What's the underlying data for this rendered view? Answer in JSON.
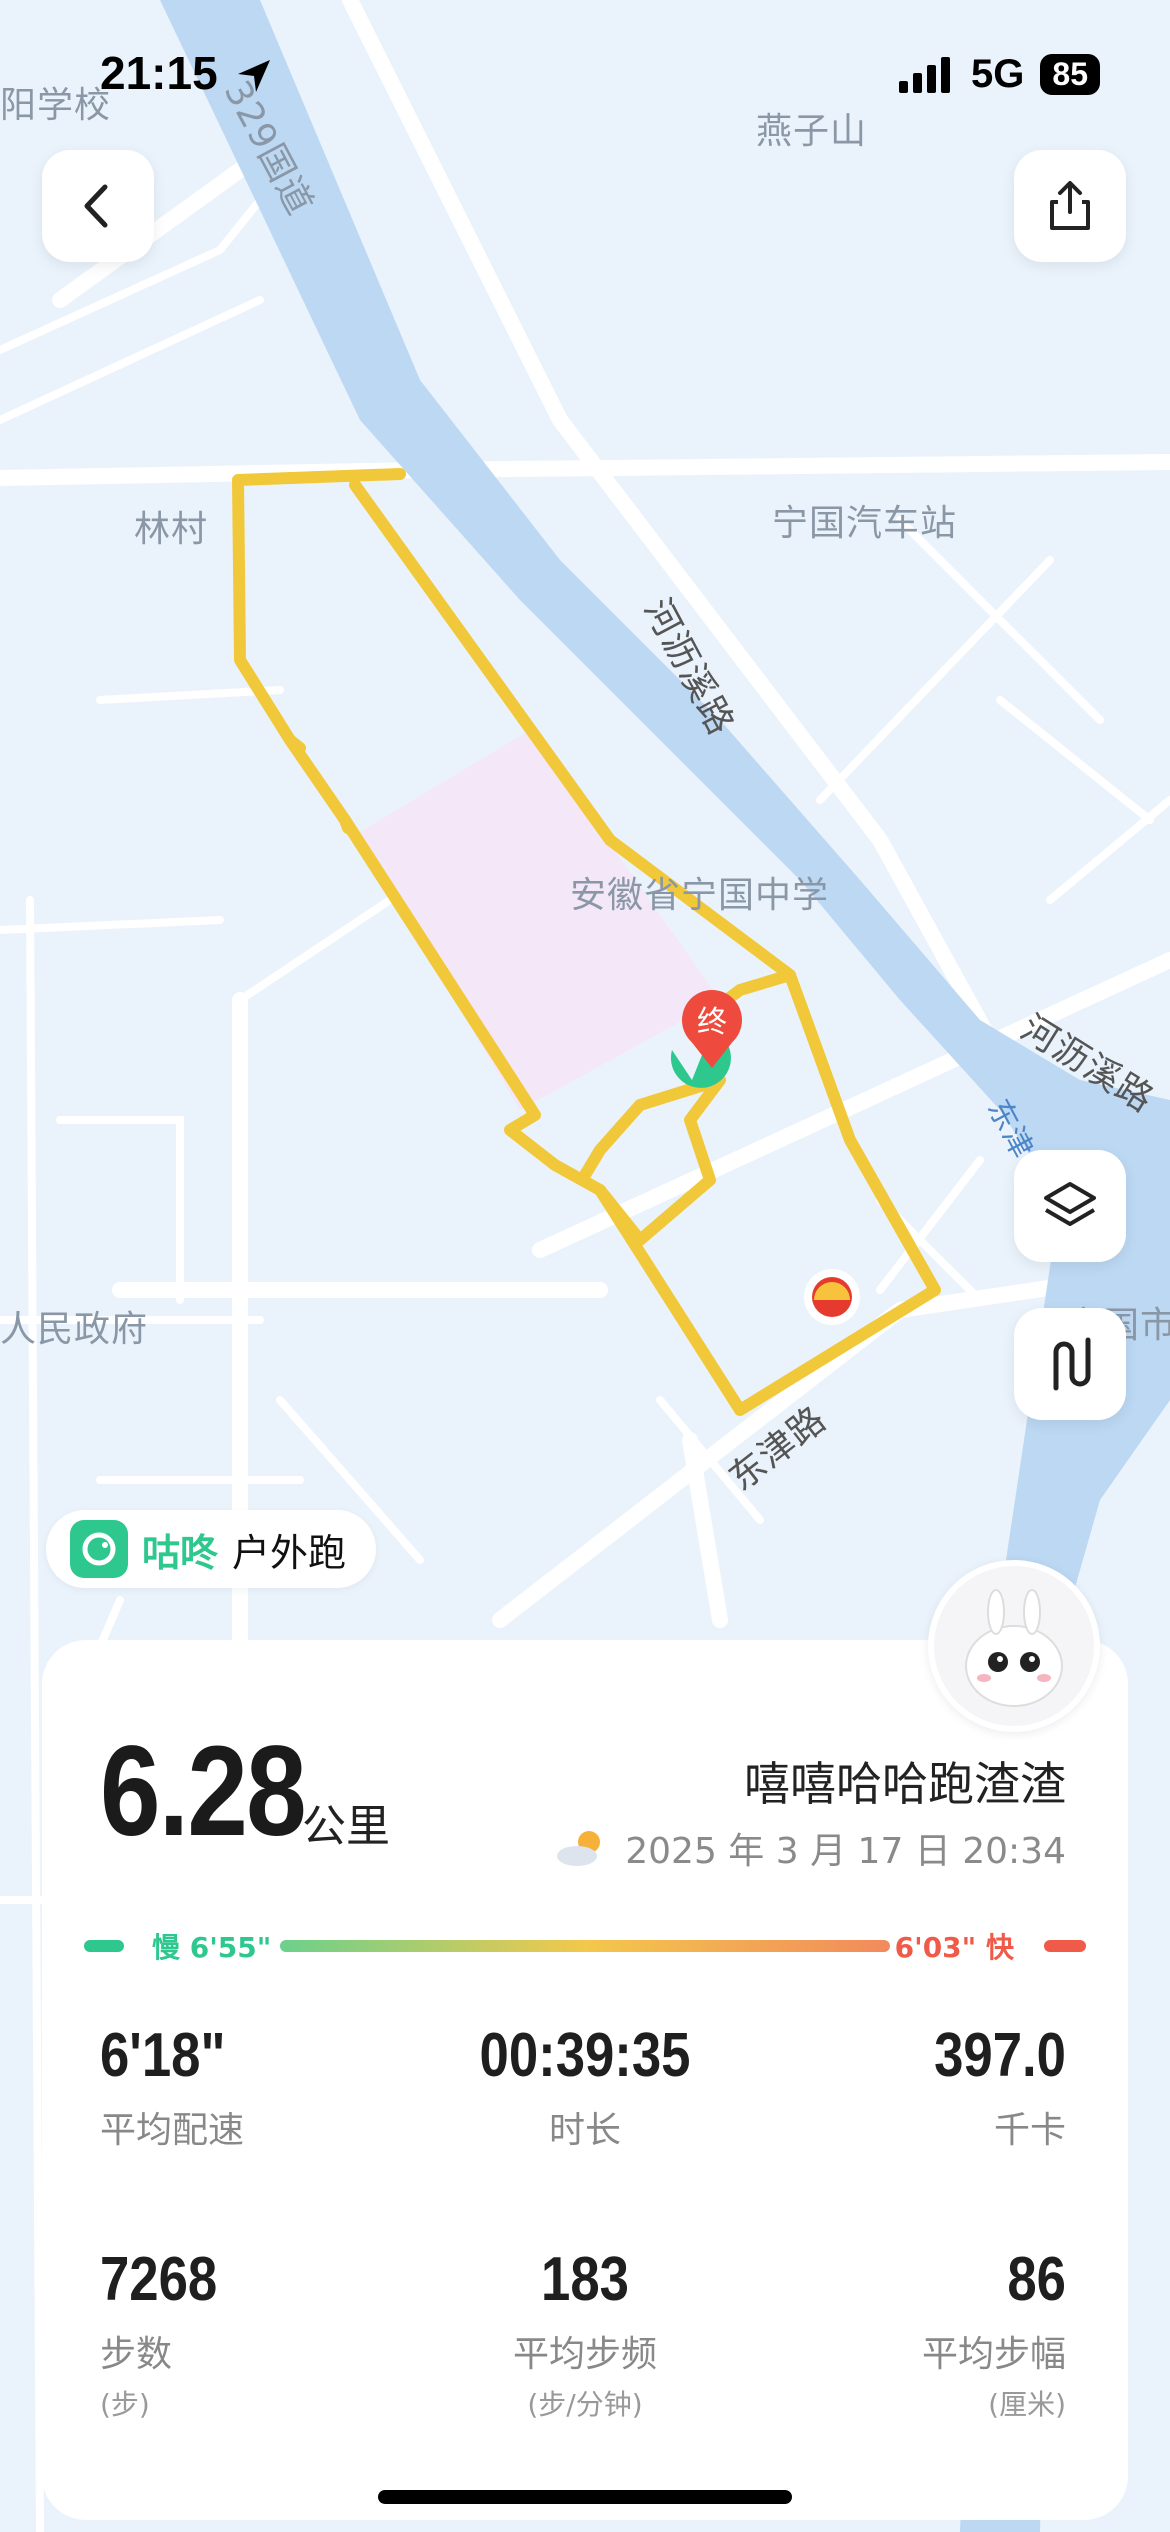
{
  "status_bar": {
    "time": "21:15",
    "network": "5G",
    "battery": "85"
  },
  "map": {
    "labels": [
      {
        "name": "label-school",
        "text": "阳学校"
      },
      {
        "name": "label-yanzishan",
        "text": "燕子山"
      },
      {
        "name": "label-road-329",
        "text": "329国道"
      },
      {
        "name": "label-lincun",
        "text": "林村"
      },
      {
        "name": "label-bus-station",
        "text": "宁国汽车站"
      },
      {
        "name": "label-hexi-road",
        "text": "河沥溪路"
      },
      {
        "name": "label-middle-school",
        "text": "安徽省宁国中学"
      },
      {
        "name": "label-hexi-road-2",
        "text": "河沥溪路"
      },
      {
        "name": "label-east-river",
        "text": "东津"
      },
      {
        "name": "label-gov",
        "text": "人民政府"
      },
      {
        "name": "label-city",
        "text": "宁国市"
      },
      {
        "name": "label-dongjin-road",
        "text": "东津路"
      }
    ],
    "end_marker": "终",
    "route_color": "#f2c83b",
    "campus_color": "#f4e8f8"
  },
  "brand": {
    "name": "咕咚",
    "mode": "户外跑"
  },
  "summary": {
    "distance": "6.28",
    "distance_unit": "公里",
    "username": "嘻嘻哈哈跑渣渣",
    "datetime": "2025 年 3 月 17 日 20:34"
  },
  "pace": {
    "slow_label": "慢 6'55\"",
    "fast_label": "6'03\" 快"
  },
  "stats": [
    {
      "value": "6'18\"",
      "label": "平均配速",
      "unit": ""
    },
    {
      "value": "00:39:35",
      "label": "时长",
      "unit": ""
    },
    {
      "value": "397.0",
      "label": "千卡",
      "unit": ""
    },
    {
      "value": "7268",
      "label": "步数",
      "unit": "(步)"
    },
    {
      "value": "183",
      "label": "平均步频",
      "unit": "(步/分钟)"
    },
    {
      "value": "86",
      "label": "平均步幅",
      "unit": "(厘米)"
    }
  ],
  "colors": {
    "accent": "#2ec88f",
    "fast": "#f05a48"
  }
}
